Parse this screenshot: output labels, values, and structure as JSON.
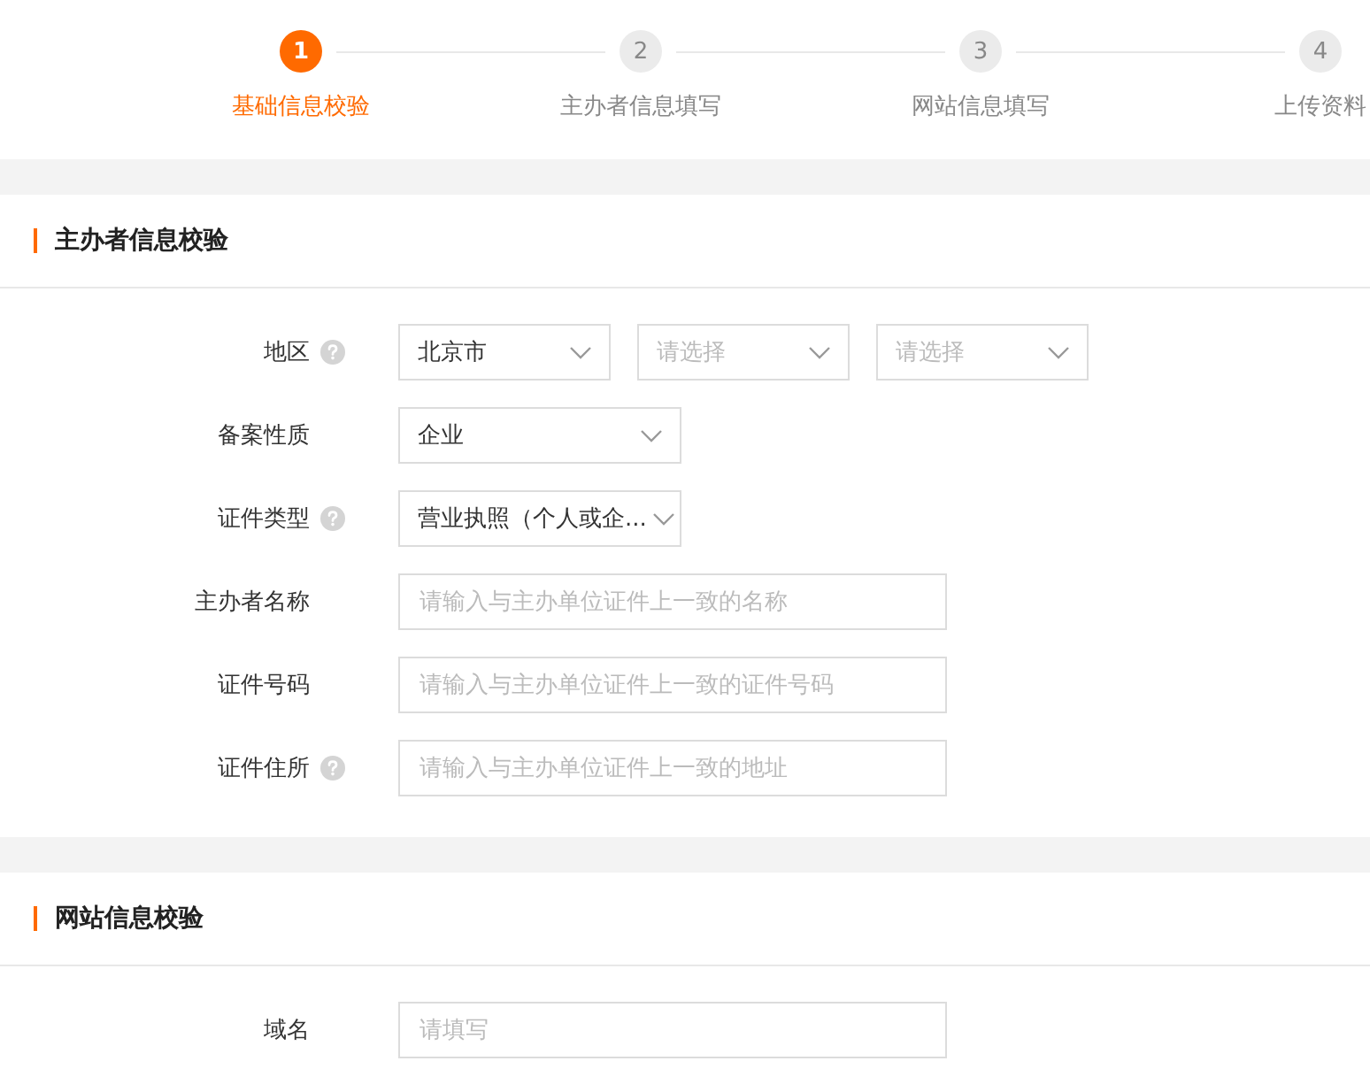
{
  "steps": [
    {
      "number": "1",
      "label": "基础信息校验",
      "selected": true
    },
    {
      "number": "2",
      "label": "主办者信息填写",
      "selected": false
    },
    {
      "number": "3",
      "label": "网站信息填写",
      "selected": false
    },
    {
      "number": "4",
      "label": "上传资料",
      "selected": false
    }
  ],
  "sections": [
    {
      "title": "主办者信息校验",
      "rows": [
        {
          "label": "地区",
          "help": true,
          "controls": [
            {
              "kind": "select",
              "value": "北京市"
            },
            {
              "kind": "select",
              "placeholder": "请选择"
            },
            {
              "kind": "select",
              "placeholder": "请选择"
            }
          ]
        },
        {
          "label": "备案性质",
          "help": false,
          "controls": [
            {
              "kind": "select",
              "value": "企业"
            }
          ]
        },
        {
          "label": "证件类型",
          "help": true,
          "controls": [
            {
              "kind": "select",
              "value": "营业执照（个人或企..."
            }
          ]
        },
        {
          "label": "主办者名称",
          "help": false,
          "controls": [
            {
              "kind": "input",
              "placeholder": "请输入与主办单位证件上一致的名称"
            }
          ]
        },
        {
          "label": "证件号码",
          "help": false,
          "controls": [
            {
              "kind": "input",
              "placeholder": "请输入与主办单位证件上一致的证件号码"
            }
          ]
        },
        {
          "label": "证件住所",
          "help": true,
          "controls": [
            {
              "kind": "input",
              "placeholder": "请输入与主办单位证件上一致的地址"
            }
          ]
        }
      ]
    },
    {
      "title": "网站信息校验",
      "rows": [
        {
          "label": "域名",
          "help": false,
          "controls": [
            {
              "kind": "input",
              "placeholder": "请填写"
            }
          ]
        }
      ]
    }
  ]
}
